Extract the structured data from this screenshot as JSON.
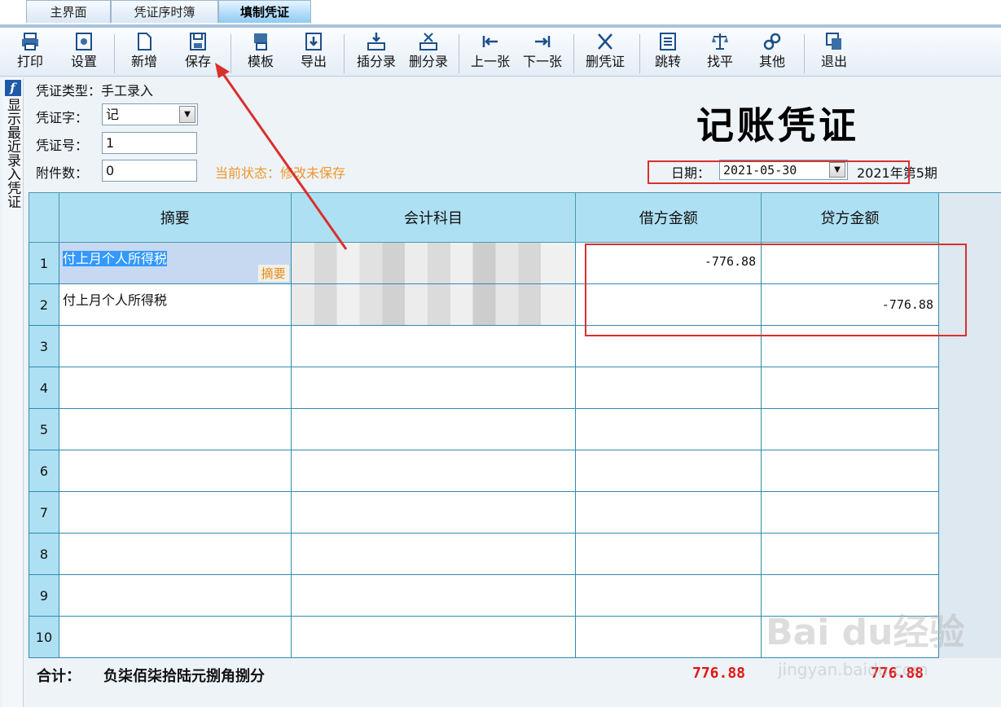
{
  "tabs": [
    {
      "label": "主界面"
    },
    {
      "label": "凭证序时簿"
    },
    {
      "label": "填制凭证"
    }
  ],
  "toolbar": {
    "print": "打印",
    "settings": "设置",
    "new": "新增",
    "save": "保存",
    "template": "模板",
    "export": "导出",
    "insert_entry": "插分录",
    "delete_entry": "删分录",
    "prev": "上一张",
    "next": "下一张",
    "delete_voucher": "删凭证",
    "jump": "跳转",
    "balance": "找平",
    "other": "其他",
    "exit": "退出"
  },
  "sidebar": {
    "vertical_label": "显示最近录入凭证"
  },
  "form": {
    "voucher_type_label": "凭证类型：",
    "voucher_type_value": "手工录入",
    "word_label": "凭证字：",
    "word_value": "记",
    "number_label": "凭证号：",
    "number_value": "1",
    "attach_label": "附件数：",
    "attach_value": "0",
    "status_text": "当前状态：修改未保存",
    "title": "记账凭证",
    "date_label": "日期：",
    "date_value": "2021-05-30",
    "period_text": "2021年第5期"
  },
  "table": {
    "headers": {
      "summary": "摘要",
      "account": "会计科目",
      "debit": "借方金额",
      "credit": "贷方金额"
    },
    "rows": [
      {
        "num": "1",
        "summary": "付上月个人所得税",
        "debit": "-776.88",
        "credit": ""
      },
      {
        "num": "2",
        "summary": "付上月个人所得税",
        "debit": "",
        "credit": "-776.88"
      },
      {
        "num": "3",
        "summary": "",
        "debit": "",
        "credit": ""
      },
      {
        "num": "4",
        "summary": "",
        "debit": "",
        "credit": ""
      },
      {
        "num": "5",
        "summary": "",
        "debit": "",
        "credit": ""
      },
      {
        "num": "6",
        "summary": "",
        "debit": "",
        "credit": ""
      },
      {
        "num": "7",
        "summary": "",
        "debit": "",
        "credit": ""
      },
      {
        "num": "8",
        "summary": "",
        "debit": "",
        "credit": ""
      },
      {
        "num": "9",
        "summary": "",
        "debit": "",
        "credit": ""
      },
      {
        "num": "10",
        "summary": "",
        "debit": "",
        "credit": ""
      }
    ],
    "cell_tag": "摘要"
  },
  "totals": {
    "label": "合计：",
    "in_words": "负柒佰柒拾陆元捌角捌分",
    "debit": "776.88",
    "credit": "776.88"
  },
  "watermark": {
    "brand": "Bai du经验",
    "url": "jingyan.baidu.com"
  },
  "colors": {
    "accent": "#aee0f3",
    "highlight": "#d9302c",
    "status": "#f0962d",
    "total": "#e21515"
  }
}
